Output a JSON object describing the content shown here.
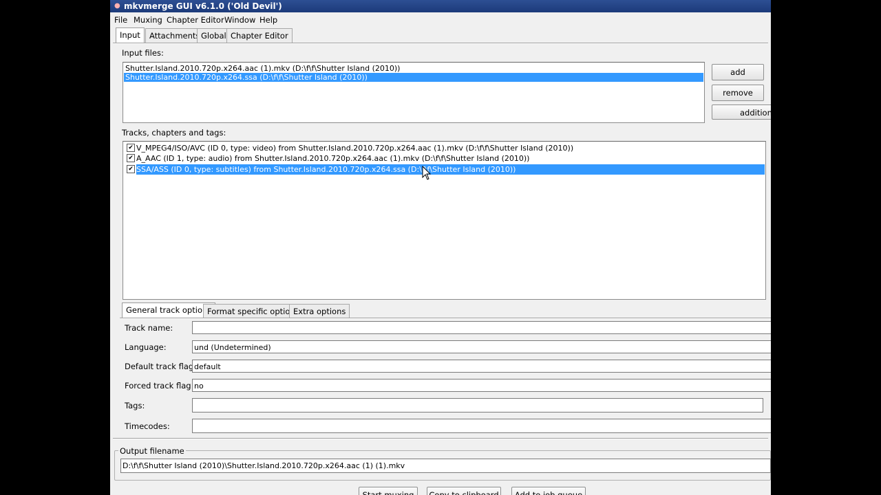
{
  "window": {
    "title": "mkvmerge GUI v6.1.0 ('Old Devil')"
  },
  "menu": [
    "File",
    "Muxing",
    "Chapter Editor",
    "Window",
    "Help"
  ],
  "main_tabs": [
    "Input",
    "Attachments",
    "Global",
    "Chapter Editor"
  ],
  "input_files": {
    "label": "Input files:",
    "items": [
      "Shutter.Island.2010.720p.x264.aac (1).mkv (D:\\f\\f\\Shutter Island (2010))",
      "Shutter.Island.2010.720p.x264.ssa (D:\\f\\f\\Shutter Island (2010))"
    ],
    "selected_index": 1,
    "buttons": {
      "add": "add",
      "remove": "remove",
      "additional": "additiona"
    }
  },
  "tracks": {
    "label": "Tracks, chapters and tags:",
    "items": [
      {
        "checked": true,
        "text": "V_MPEG4/ISO/AVC (ID 0, type: video) from Shutter.Island.2010.720p.x264.aac (1).mkv (D:\\f\\f\\Shutter Island (2010))"
      },
      {
        "checked": true,
        "text": "A_AAC (ID 1, type: audio) from Shutter.Island.2010.720p.x264.aac (1).mkv (D:\\f\\f\\Shutter Island (2010))"
      },
      {
        "checked": true,
        "text": "SSA/ASS (ID 0, type: subtitles) from Shutter.Island.2010.720p.x264.ssa (D:\\f\\f\\Shutter Island (2010))"
      }
    ],
    "selected_index": 2
  },
  "options_tabs": [
    "General track options",
    "Format specific options",
    "Extra options"
  ],
  "general_options": {
    "track_name_label": "Track name:",
    "track_name_value": "",
    "language_label": "Language:",
    "language_value": "und (Undetermined)",
    "default_flag_label": "Default track flag:",
    "default_flag_value": "default",
    "forced_flag_label": "Forced track flag:",
    "forced_flag_value": "no",
    "tags_label": "Tags:",
    "tags_value": "",
    "timecodes_label": "Timecodes:",
    "timecodes_value": ""
  },
  "output": {
    "label": "Output filename",
    "value": "D:\\f\\f\\Shutter Island (2010)\\Shutter.Island.2010.720p.x264.aac (1) (1).mkv"
  },
  "bottom_buttons": [
    "Start muxing",
    "Copy to clipboard",
    "Add to job queue"
  ],
  "colors": {
    "selection": "#3399ff",
    "titlebar": "#1c3a7a",
    "background": "#f0f0f0"
  }
}
